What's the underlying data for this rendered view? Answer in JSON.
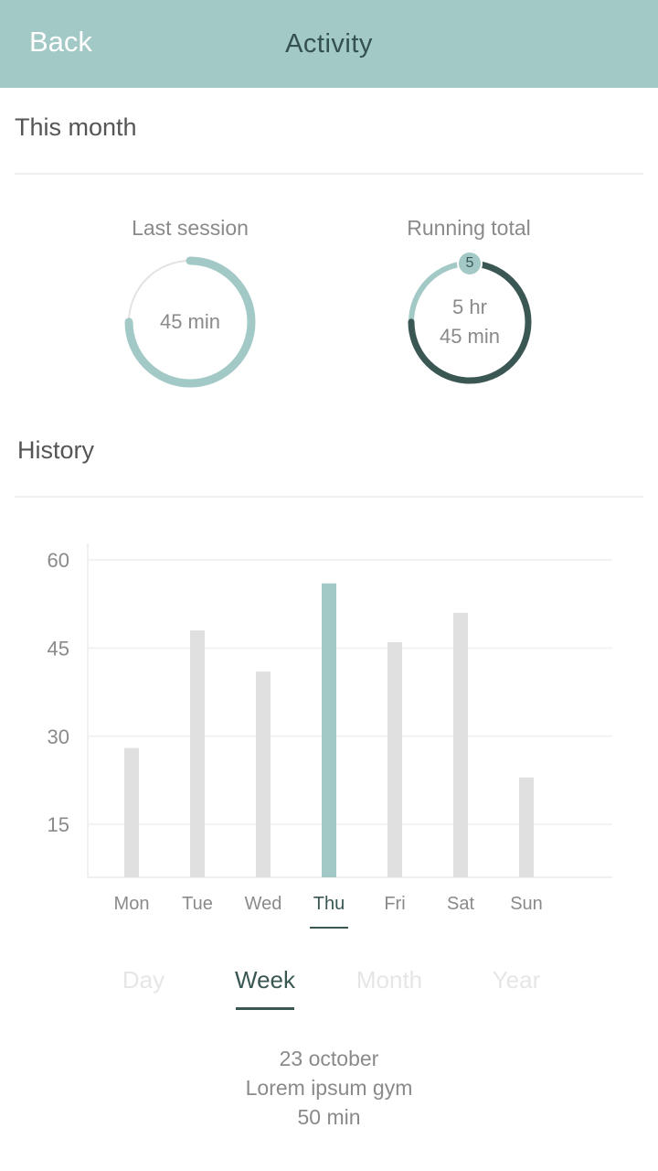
{
  "header": {
    "back_label": "Back",
    "title": "Activity"
  },
  "this_month": {
    "title": "This month",
    "last_session": {
      "label": "Last session",
      "value": "45 min",
      "fraction": 0.75
    },
    "running_total": {
      "label": "Running total",
      "line1": "5 hr",
      "line2": "45 min",
      "badge": "5",
      "fraction": 0.75
    }
  },
  "history": {
    "title": "History"
  },
  "colors": {
    "accent": "#a3c9c6",
    "dark": "#3a5754",
    "bar": "#e0e0e0",
    "muted": "#8a8a8a"
  },
  "chart_data": {
    "type": "bar",
    "categories": [
      "Mon",
      "Tue",
      "Wed",
      "Thu",
      "Fri",
      "Sat",
      "Sun"
    ],
    "values": [
      28,
      48,
      41,
      56,
      46,
      51,
      23
    ],
    "highlight": "Thu",
    "yticks": [
      60,
      45,
      30,
      15
    ],
    "ylim": [
      6,
      60
    ],
    "grid": true
  },
  "tabs": [
    {
      "label": "Day",
      "active": false
    },
    {
      "label": "Week",
      "active": true
    },
    {
      "label": "Month",
      "active": false
    },
    {
      "label": "Year",
      "active": false
    }
  ],
  "selected_entry": {
    "date": "23 october",
    "place": "Lorem ipsum gym",
    "duration": "50 min"
  }
}
